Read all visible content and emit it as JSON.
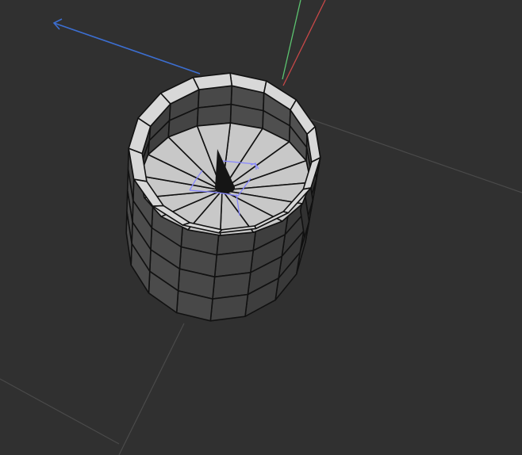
{
  "viewport": {
    "background": "#303030",
    "grid_color": "#4a4a4a",
    "axis_colors": {
      "x": "#c84848",
      "y": "#5cc470",
      "z": "#3c6ed0"
    },
    "mesh": {
      "type": "cylinder",
      "segments": 16,
      "side_rows": 4,
      "face_color": "#4a4a4a",
      "rim_color": "#d8d8d8",
      "floor_color": "#c8c8c8",
      "edge_color": "#111111"
    },
    "gizmo_color": "#8888ff",
    "gizmo_icon": "transform-gizmo-icon"
  }
}
